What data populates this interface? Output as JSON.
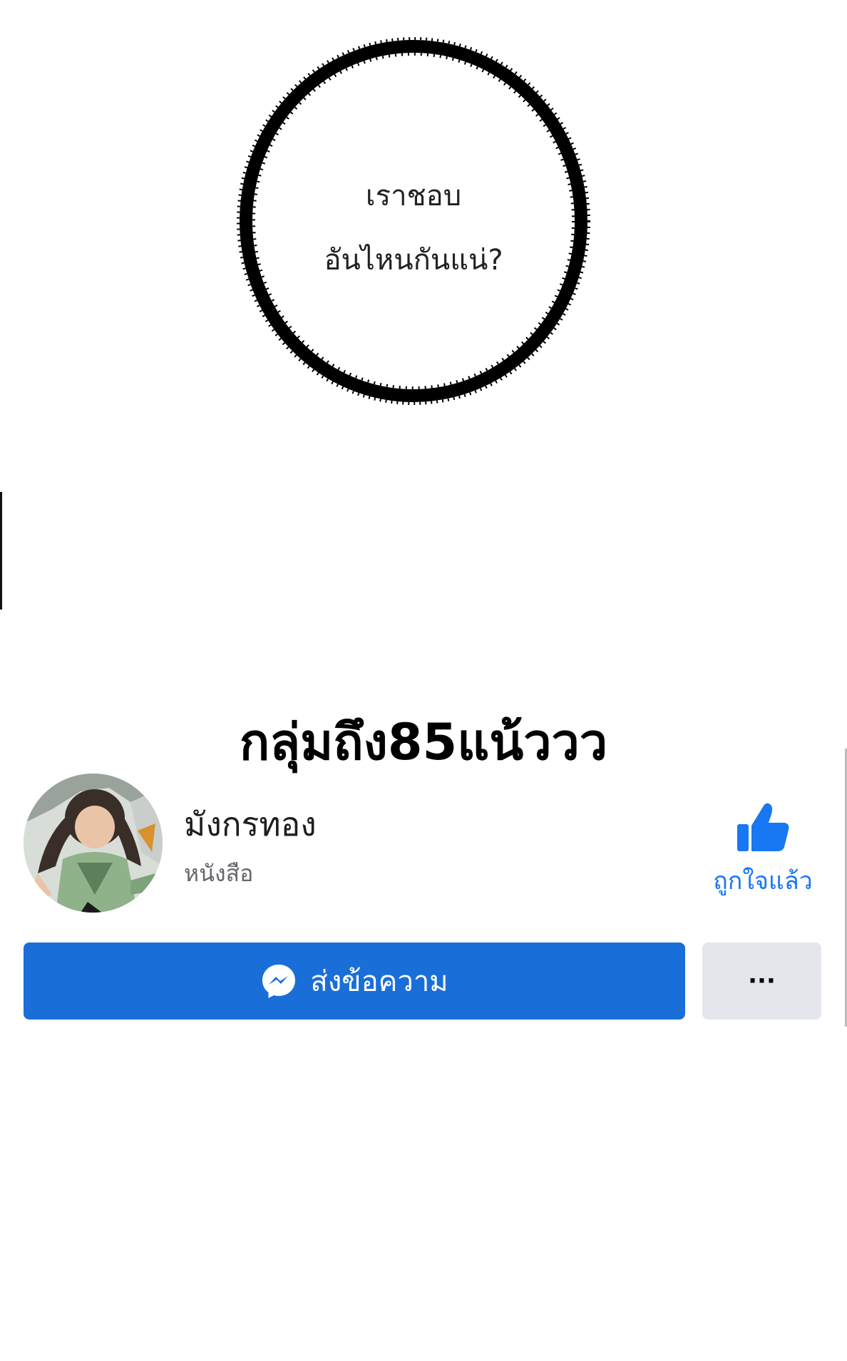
{
  "bubble": {
    "line1": "เราชอบ",
    "line2": "อันไหนกันแน่?"
  },
  "headline": "กลุ่มถึง85แน้ววว",
  "page_card": {
    "name": "มังกรทอง",
    "category": "หนังสือ",
    "like_label": "ถูกใจแล้ว",
    "send_message_label": "ส่งข้อความ",
    "more_label": "···"
  },
  "colors": {
    "facebook_blue": "#1877f2",
    "button_blue": "#1a6ed8",
    "secondary_button": "#e4e6eb"
  },
  "icons": {
    "like": "thumbs-up-icon",
    "messenger": "messenger-icon",
    "more": "more-dots-icon"
  }
}
